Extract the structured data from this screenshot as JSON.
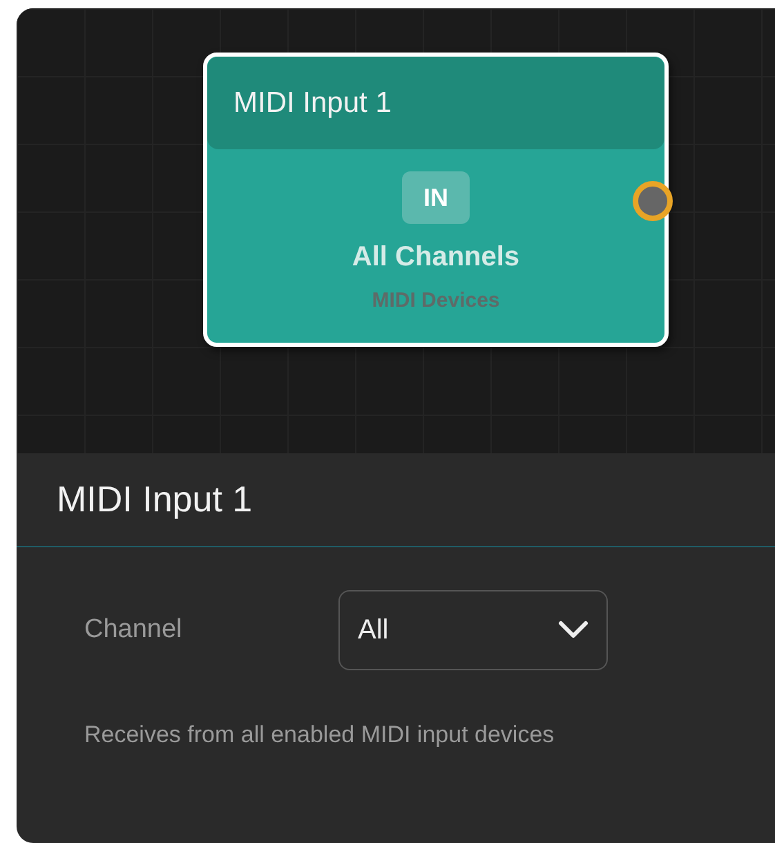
{
  "canvas": {
    "nodes": [
      {
        "title": "MIDI Input 1",
        "badge": "IN",
        "label": "All Channels",
        "sublabel": "MIDI Devices",
        "selected": true
      }
    ]
  },
  "inspector": {
    "title": "MIDI Input 1",
    "fields": [
      {
        "label": "Channel",
        "value": "All"
      }
    ],
    "description": "Receives from all enabled MIDI input devices"
  }
}
